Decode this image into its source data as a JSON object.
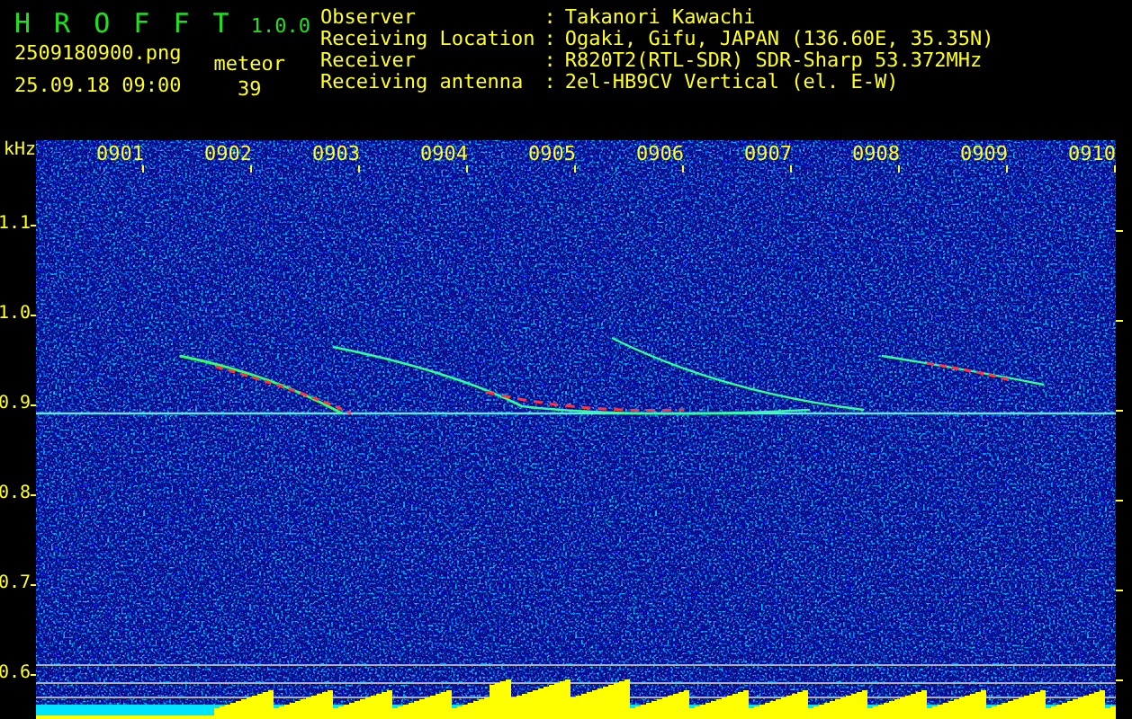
{
  "app": {
    "title": "H R O F F T",
    "version": "1.0.0"
  },
  "file_name": "2509180900.png",
  "timestamp": "25.09.18 09:00",
  "meteor": {
    "label": "meteor",
    "count": "39"
  },
  "station_info": [
    {
      "label": "Observer",
      "separator": ":",
      "value": "Takanori Kawachi"
    },
    {
      "label": "Receiving Location",
      "separator": ":",
      "value": "Ogaki, Gifu, JAPAN (136.60E, 35.35N)"
    },
    {
      "label": "Receiver",
      "separator": ":",
      "value": "R820T2(RTL-SDR) SDR-Sharp 53.372MHz"
    },
    {
      "label": "Receiving antenna",
      "separator": ":",
      "value": "2el-HB9CV Vertical (el. E-W)"
    }
  ],
  "spectrogram": {
    "unit": "kHz",
    "time_labels": [
      "0901",
      "0902",
      "0903",
      "0904",
      "0905",
      "0906",
      "0907",
      "0908",
      "0909",
      "0910"
    ],
    "frequency_labels": [
      "1.1",
      "1.0",
      "0.9",
      "0.8",
      "0.7",
      "0.6"
    ]
  }
}
